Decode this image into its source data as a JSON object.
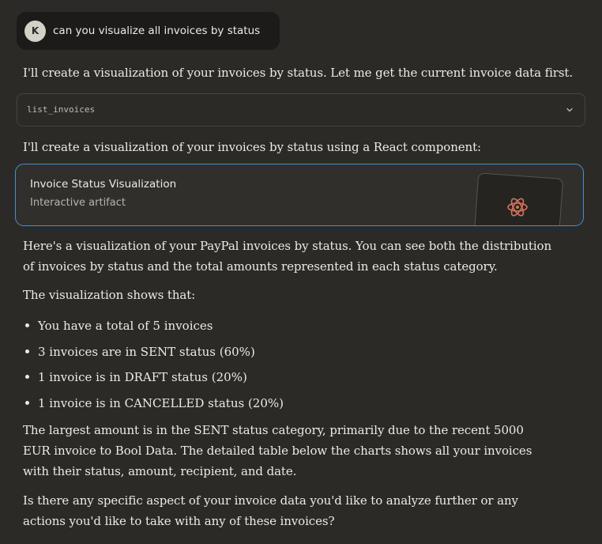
{
  "user_message": {
    "avatar_initial": "K",
    "text": "can you visualize all invoices by status"
  },
  "assistant": {
    "intro": "I'll create a visualization of your invoices by status. Let me get the current invoice data first.",
    "tool_call": {
      "name": "list_invoices",
      "icon": "chevron-down-icon"
    },
    "lead_in": "I'll create a visualization of your invoices by status using a React component:",
    "artifact": {
      "title": "Invoice Status Visualization",
      "subtitle": "Interactive artifact",
      "icon": "react-atom-icon",
      "accent_color": "#4a8dd4",
      "icon_color": "#d9735a"
    },
    "summary": "Here's a visualization of your PayPal invoices by status. You can see both the distribution of invoices by status and the total amounts represented in each status category.",
    "shows_heading": "The visualization shows that:",
    "bullets": [
      "You have a total of 5 invoices",
      "3 invoices are in SENT status (60%)",
      "1 invoice is in DRAFT status (20%)",
      "1 invoice is in CANCELLED status (20%)"
    ],
    "detail": "The largest amount is in the SENT status category, primarily due to the recent 5000 EUR invoice to Bool Data. The detailed table below the charts shows all your invoices with their status, amount, recipient, and date.",
    "question": "Is there any specific aspect of your invoice data you'd like to analyze further or any actions you'd like to take with any of these invoices?"
  }
}
